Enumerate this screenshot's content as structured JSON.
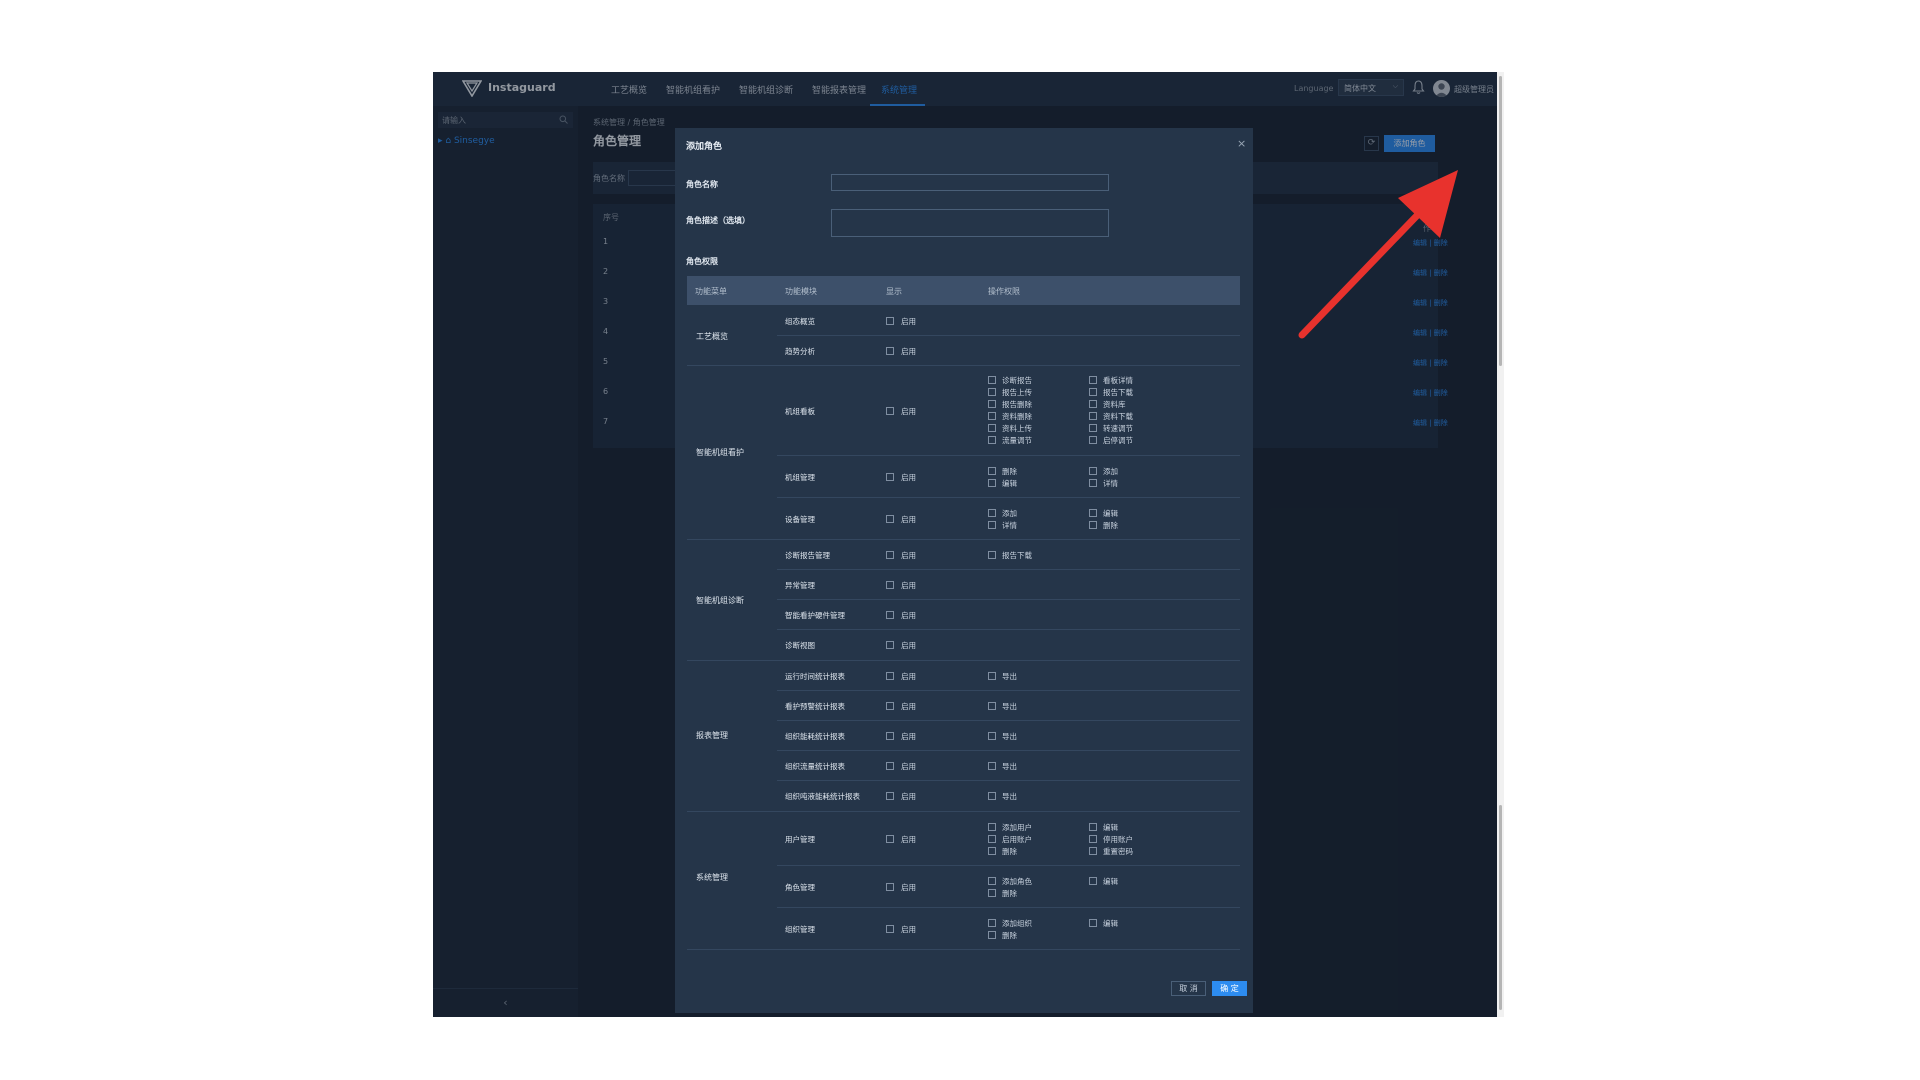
{
  "header": {
    "brand": "Instaguard",
    "nav": [
      "工艺概览",
      "智能机组看护",
      "智能机组诊断",
      "智能报表管理",
      "系统管理"
    ],
    "language_label": "Language",
    "language_value": "简体中文",
    "user_name": "超级管理员"
  },
  "sidebar": {
    "search_placeholder": "请输入",
    "tree_node": "▸ ⌂ Sinsegye",
    "collapse": "‹"
  },
  "page": {
    "breadcrumb": "系统管理 / 角色管理",
    "title": "角色管理",
    "refresh": "⟳",
    "add_button": "添加角色",
    "filter_label": "角色名称",
    "table_head_seq": "序号",
    "table_head_ops": "操作",
    "rows": [
      "1",
      "2",
      "3",
      "4",
      "5",
      "6",
      "7"
    ],
    "row_ops": "编辑 | 删除"
  },
  "modal": {
    "title": "添加角色",
    "close": "×",
    "field_role_name": "角色名称",
    "field_role_desc": "角色描述（选填）",
    "perm_title": "角色权限",
    "perm_head": [
      "功能菜单",
      "功能模块",
      "显示",
      "操作权限"
    ],
    "enable": "启用",
    "menus": {
      "m1": "工艺概览",
      "m2": "智能机组看护",
      "m3": "智能机组诊断",
      "m4": "报表管理",
      "m5": "系统管理"
    },
    "modules": {
      "r1": "组态概览",
      "r2": "趋势分析",
      "r3": "机组看板",
      "r4": "机组管理",
      "r5": "设备管理",
      "r6": "诊断报告管理",
      "r7": "异常管理",
      "r8": "智能看护硬件管理",
      "r9": "诊断视图",
      "r10": "运行时间统计报表",
      "r11": "看护预警统计报表",
      "r12": "组织能耗统计报表",
      "r13": "组织流量统计报表",
      "r14": "组织吨液能耗统计报表",
      "r15": "用户管理",
      "r16": "角色管理",
      "r17": "组织管理"
    },
    "ops": {
      "r3a": [
        "诊断报告",
        "报告上传",
        "报告删除",
        "资料删除",
        "资料上传",
        "流量调节"
      ],
      "r3b": [
        "看板详情",
        "报告下载",
        "资料库",
        "资料下载",
        "转速调节",
        "启停调节"
      ],
      "r4a": [
        "删除",
        "编辑"
      ],
      "r4b": [
        "添加",
        "详情"
      ],
      "r5a": [
        "添加",
        "详情"
      ],
      "r5b": [
        "编辑",
        "删除"
      ],
      "r6a": [
        "报告下载"
      ],
      "export": "导出",
      "r15a": [
        "添加用户",
        "启用账户",
        "删除"
      ],
      "r15b": [
        "编辑",
        "停用账户",
        "重置密码"
      ],
      "r16a": [
        "添加角色",
        "删除"
      ],
      "r16b": [
        "编辑"
      ],
      "r17a": [
        "添加组织",
        "删除"
      ],
      "r17b": [
        "编辑"
      ]
    },
    "cancel": "取 消",
    "ok": "确 定"
  },
  "colors": {
    "accent": "#2d8cf0",
    "background": "#1a2636",
    "modal": "#253549",
    "arrow": "#e8322d"
  }
}
